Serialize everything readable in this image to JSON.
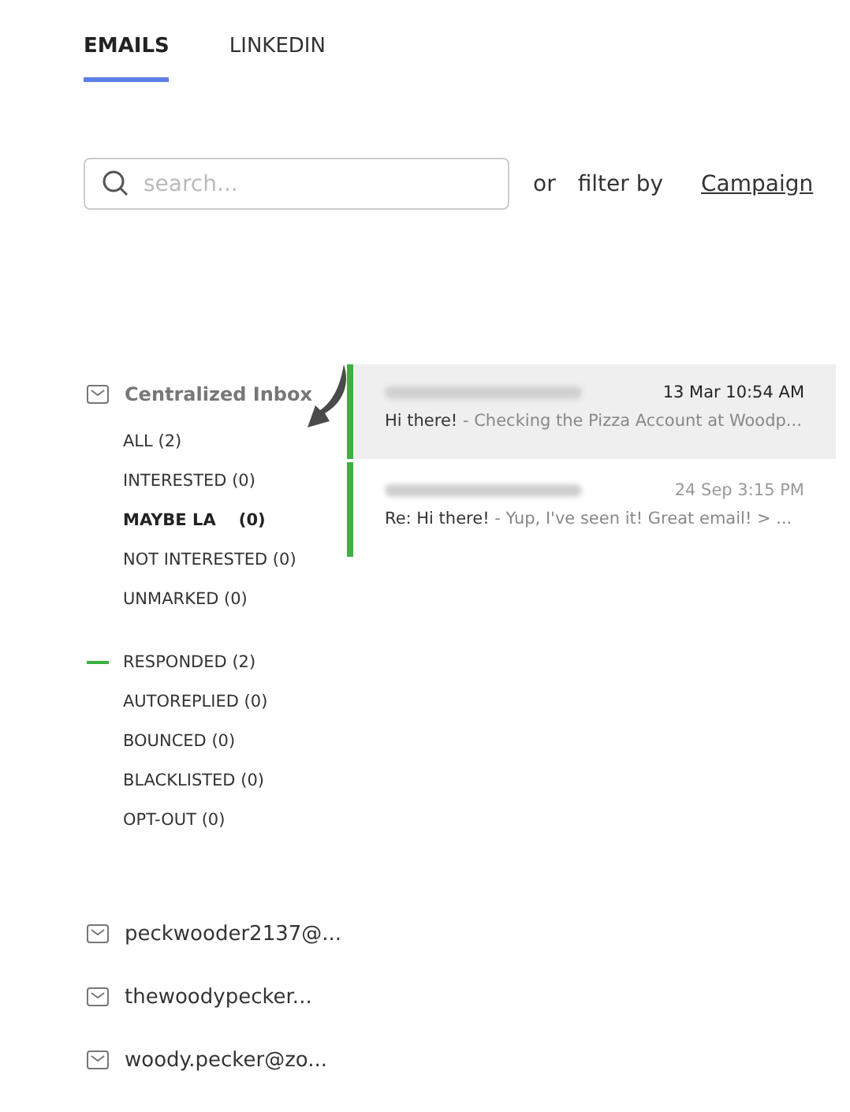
{
  "tabs": [
    {
      "label": "EMAILS",
      "selected": true
    },
    {
      "label": "LINKEDIN",
      "selected": false
    }
  ],
  "search": {
    "placeholder": "search..."
  },
  "filter": {
    "or": "or",
    "label": "filter by",
    "link": "Campaign"
  },
  "inbox": {
    "title": "Centralized Inbox"
  },
  "groups": [
    {
      "items": [
        {
          "label": "ALL (2)",
          "selected": false,
          "indicator": false
        },
        {
          "label": "INTERESTED (0)",
          "selected": false,
          "indicator": false
        },
        {
          "label": "MAYBE LA",
          "count": "(0)",
          "selected": true,
          "indicator": false
        },
        {
          "label": "NOT INTERESTED (0)",
          "selected": false,
          "indicator": false
        },
        {
          "label": "UNMARKED (0)",
          "selected": false,
          "indicator": false
        }
      ]
    },
    {
      "items": [
        {
          "label": "RESPONDED (2)",
          "selected": false,
          "indicator": true
        },
        {
          "label": "AUTOREPLIED (0)",
          "selected": false,
          "indicator": false
        },
        {
          "label": "BOUNCED (0)",
          "selected": false,
          "indicator": false
        },
        {
          "label": "BLACKLISTED (0)",
          "selected": false,
          "indicator": false
        },
        {
          "label": "OPT-OUT (0)",
          "selected": false,
          "indicator": false
        }
      ]
    }
  ],
  "accounts": [
    {
      "label": "peckwooder2137@..."
    },
    {
      "label": "thewoodypecker..."
    },
    {
      "label": "woody.pecker@zo..."
    }
  ],
  "emails": [
    {
      "date": "13 Mar 10:54 AM",
      "subject": "Hi there!",
      "preview": " - Checking the Pizza Account at Woodp...",
      "selected": true
    },
    {
      "date": "24 Sep 3:15 PM",
      "subject": "Re: Hi there!",
      "preview": " - Yup, I've seen it! Great email! > ...",
      "selected": false
    }
  ]
}
